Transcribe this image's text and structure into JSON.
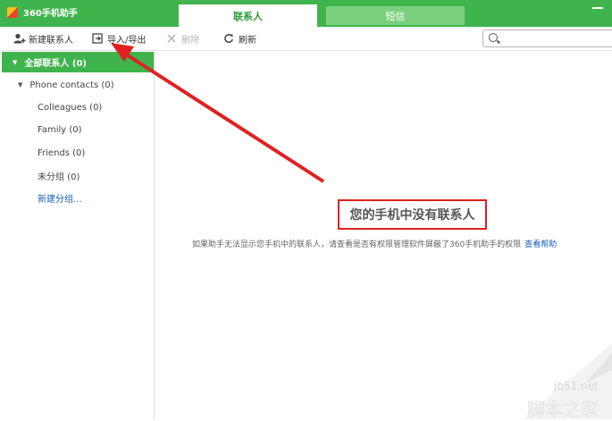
{
  "window": {
    "app_title": "360手机助手"
  },
  "tabs": {
    "contacts": "联系人",
    "sms": "短信"
  },
  "toolbar": {
    "new_contact": "新建联系人",
    "import_export": "导入/导出",
    "delete": "删除",
    "refresh": "刷新",
    "search_placeholder": ""
  },
  "sidebar": {
    "all_contacts": "全部联系人 (0)",
    "phone_contacts": "Phone contacts (0)",
    "groups": [
      "Colleagues (0)",
      "Family (0)",
      "Friends (0)",
      "未分组 (0)"
    ],
    "new_group": "新建分组..."
  },
  "main": {
    "empty_title": "您的手机中没有联系人",
    "empty_hint": "如果助手无法显示您手机中的联系人，请查看是否有权限管理软件屏蔽了360手机助手的权限",
    "help_link": "查看帮助"
  },
  "watermark": {
    "site": "jb51.net",
    "name": "脚本之家"
  },
  "colors": {
    "brand_green": "#3fb44c",
    "annotation_red": "#e02020",
    "link_blue": "#1a5fb4"
  }
}
